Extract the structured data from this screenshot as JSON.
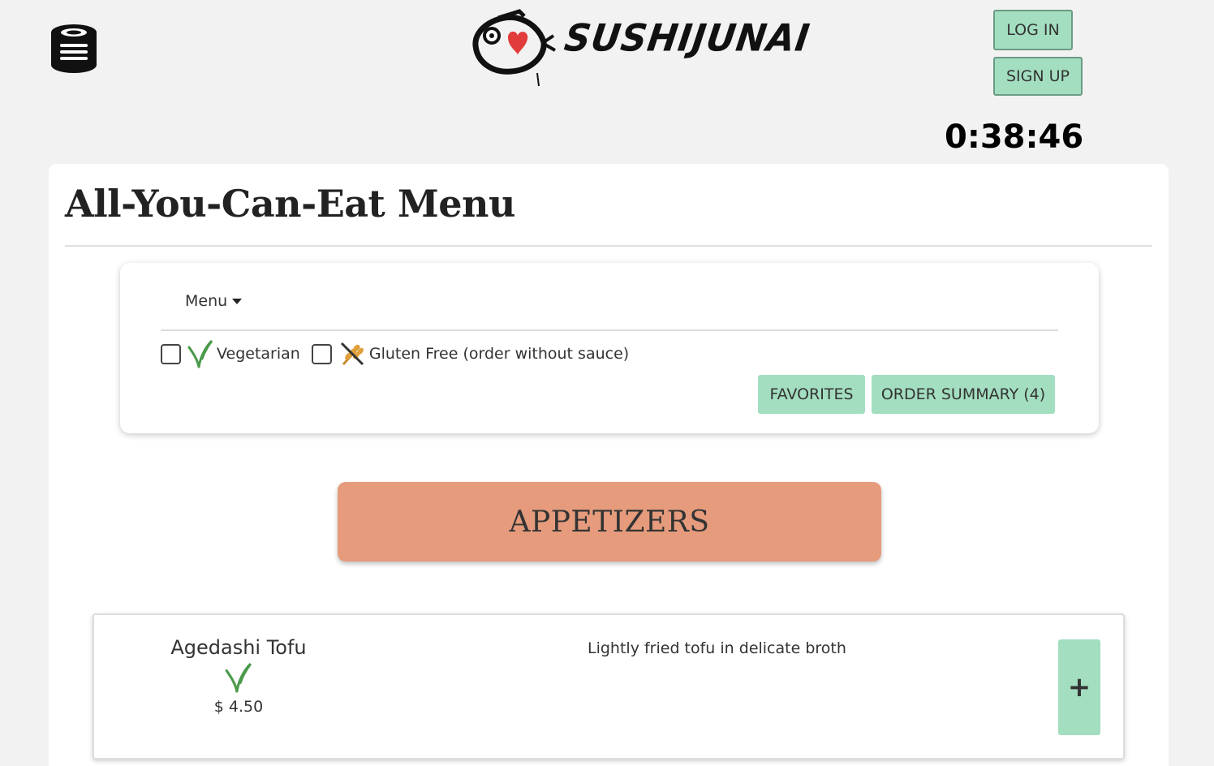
{
  "brand": {
    "name": "SUSHIJUNAI"
  },
  "auth": {
    "login_label": "LOG IN",
    "signup_label": "SIGN UP"
  },
  "timer": {
    "value": "0:38:46"
  },
  "page": {
    "title": "All-You-Can-Eat Menu"
  },
  "filters": {
    "menu_dropdown_label": "Menu",
    "vegetarian_label": "Vegetarian",
    "gluten_free_label": "Gluten Free (order without sauce)",
    "vegetarian_checked": false,
    "gluten_free_checked": false,
    "favorites_label": "FAVORITES",
    "order_summary_label": "ORDER SUMMARY (4)"
  },
  "category": {
    "label": "APPETIZERS"
  },
  "items": [
    {
      "name": "Agedashi Tofu",
      "price": "$ 4.50",
      "description": "Lightly fried tofu in delicate broth",
      "add_label": "+"
    }
  ],
  "icons": {
    "sushi_icon": "sushi-stack-icon",
    "vegetarian_icon": "leaf-icon",
    "gluten_free_icon": "no-wheat-icon"
  },
  "colors": {
    "accent_green": "#a3dec0",
    "category_orange": "#e59b7c",
    "background": "#f2f2f2",
    "leaf_green": "#4a9a4a"
  }
}
